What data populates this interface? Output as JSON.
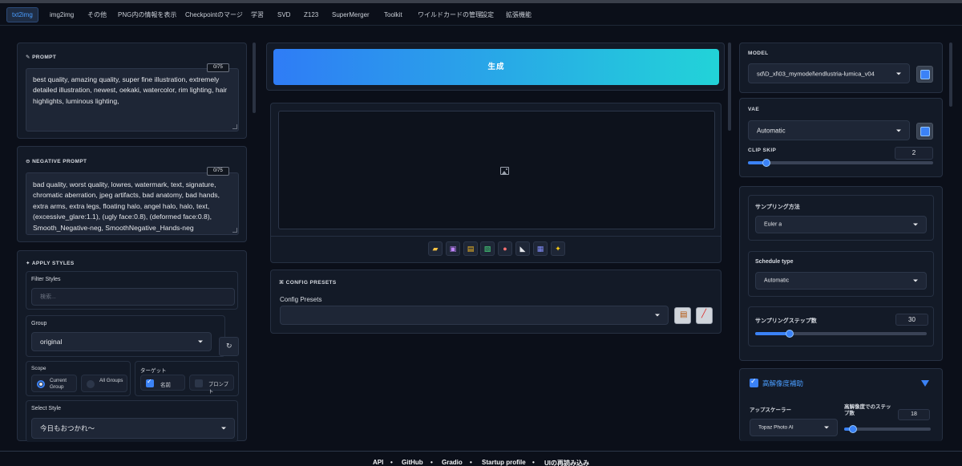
{
  "tabs": [
    "txt2img",
    "img2img",
    "その他",
    "PNG内の情報を表示",
    "Checkpointのマージ",
    "学習",
    "SVD",
    "Z123",
    "SuperMerger",
    "Toolkit",
    "ワイルドカードの管理",
    "設定",
    "拡張機能"
  ],
  "active_tab": "txt2img",
  "prompt": {
    "label": "PROMPT",
    "counter": "0/75",
    "text": "best quality, amazing quality, super fine illustration, extremely detailed illustration, newest, oekaki, watercolor, rim lighting, hair highlights, luminous lighting,"
  },
  "negative_prompt": {
    "label": "NEGATIVE PROMPT",
    "counter": "0/75",
    "text": "bad quality, worst quality, lowres, watermark, text, signature, chromatic aberration, jpeg artifacts, bad anatomy, bad hands, extra arms, extra legs, floating halo, angel halo, halo, text, (excessive_glare:1.1), (ugly face:0.8), (deformed face:0.8), Smooth_Negative-neg, SmoothNegative_Hands-neg"
  },
  "styles": {
    "label": "APPLY STYLES",
    "filter_label": "Filter Styles",
    "filter_placeholder": "検索...",
    "group_label": "Group",
    "group_value": "original",
    "scope_label": "Scope",
    "scope_options": [
      "Current Group",
      "All Groups"
    ],
    "target_label": "ターゲット",
    "target_options": [
      "名前",
      "プロンプト"
    ],
    "select_style_label": "Select Style",
    "select_style_value": "今日もおつかれ〜"
  },
  "generate_label": "生成",
  "config_presets": {
    "section_label": "CONFIG PRESETS",
    "field_label": "Config Presets",
    "value": ""
  },
  "model": {
    "label": "MODEL",
    "value": "sd\\D_xl\\03_mymodel\\endlustria-lumica_v04"
  },
  "vae": {
    "label": "VAE",
    "value": "Automatic"
  },
  "clip_skip": {
    "label": "CLIP SKIP",
    "value": "2",
    "fraction": 0.1
  },
  "sampler": {
    "label": "サンプリング方法",
    "value": "Euler a"
  },
  "schedule": {
    "label": "Schedule type",
    "value": "Automatic"
  },
  "steps": {
    "label": "サンプリングステップ数",
    "value": "30",
    "fraction": 0.2
  },
  "hires": {
    "label": "高解像度補助",
    "checked": true,
    "upscaler_label": "アップスケーラー",
    "upscaler_value": "Topaz Photo AI",
    "hires_steps_label": "高解像度でのステップ数",
    "hires_steps_value": "18",
    "fraction": 0.1
  },
  "footer": [
    "API",
    "GitHub",
    "Gradio",
    "Startup profile",
    "UIの再読み込み"
  ],
  "colors": {
    "accent": "#3b82f6",
    "generate_start": "#2f7cf6",
    "generate_end": "#22d3d8",
    "background": "#0b0f19",
    "panel": "#131a27"
  },
  "tool_icons": [
    "folder-icon",
    "save-icon",
    "archive-icon",
    "image-icon",
    "palette-icon",
    "ruler-icon",
    "clipboard-icon",
    "sparkle-icon"
  ]
}
